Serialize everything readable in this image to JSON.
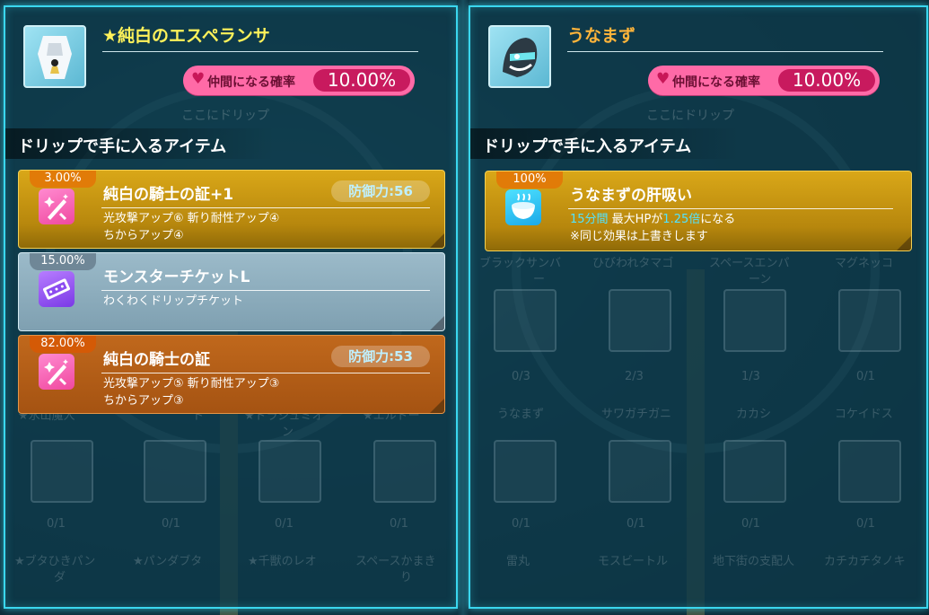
{
  "left": {
    "monster_name": "★純白のエスペランサ",
    "rate_label": "仲間になる確率",
    "rate_value": "10.00%",
    "ghost_text": "ここにドリップ",
    "section_title": "ドリップで手に入るアイテム",
    "items": [
      {
        "percent": "3.00%",
        "name": "純白の騎士の証+1",
        "stat": "防御力:56",
        "desc1": "光攻撃アップ⑥ 斬り耐性アップ④",
        "desc2": "ちからアップ④",
        "icon": "sword-sparkle-icon"
      },
      {
        "percent": "15.00%",
        "name": "モンスターチケットL",
        "stat": "",
        "desc1": "わくわくドリップチケット",
        "desc2": "",
        "icon": "ticket-icon"
      },
      {
        "percent": "82.00%",
        "name": "純白の騎士の証",
        "stat": "防御力:53",
        "desc1": "光攻撃アップ⑤ 斬り耐性アップ③",
        "desc2": "ちからアップ③",
        "icon": "sword-sparkle-icon"
      }
    ],
    "background_labels": [
      "★氷山魔人",
      "ト",
      "★ドラジュミオ",
      "ン",
      "★エルドー",
      "0/1",
      "0/1",
      "0/1",
      "0/1",
      "★ブタひきパン",
      "ダ",
      "★パンダブタ",
      "★千獣のレオ",
      "スペースかまき",
      "り"
    ]
  },
  "right": {
    "monster_name": "うなまず",
    "rate_label": "仲間になる確率",
    "rate_value": "10.00%",
    "ghost_text": "ここにドリップ",
    "section_title": "ドリップで手に入るアイテム",
    "item": {
      "percent": "100%",
      "name": "うなまずの肝吸い",
      "duration": "15分間",
      "desc_mid": " 最大HPが",
      "multiplier": "1.25倍",
      "desc_end": "になる",
      "note": "※同じ効果は上書きします",
      "icon": "soup-bowl-icon"
    },
    "background_labels": [
      "ブラックサンバ",
      "ひびわれタマゴ",
      "スペースエンパ",
      "マグネッコ",
      "ー",
      "ーン",
      "0/3",
      "2/3",
      "1/3",
      "0/1",
      "うなまず",
      "サワガチガニ",
      "カカシ",
      "コケイドス",
      "0/1",
      "0/1",
      "0/1",
      "0/1",
      "雷丸",
      "モスビートル",
      "地下街の支配人",
      "カチカチタノキ"
    ]
  },
  "colors": {
    "panel_border": "#3ad7ef",
    "gold_card": "#d9a718",
    "bronze_card": "#c0681c",
    "silver_card": "#9bbac9",
    "rate_pill": "#ff6aa7",
    "name_yellow": "#fff25a",
    "name_orange": "#ffb43a"
  }
}
